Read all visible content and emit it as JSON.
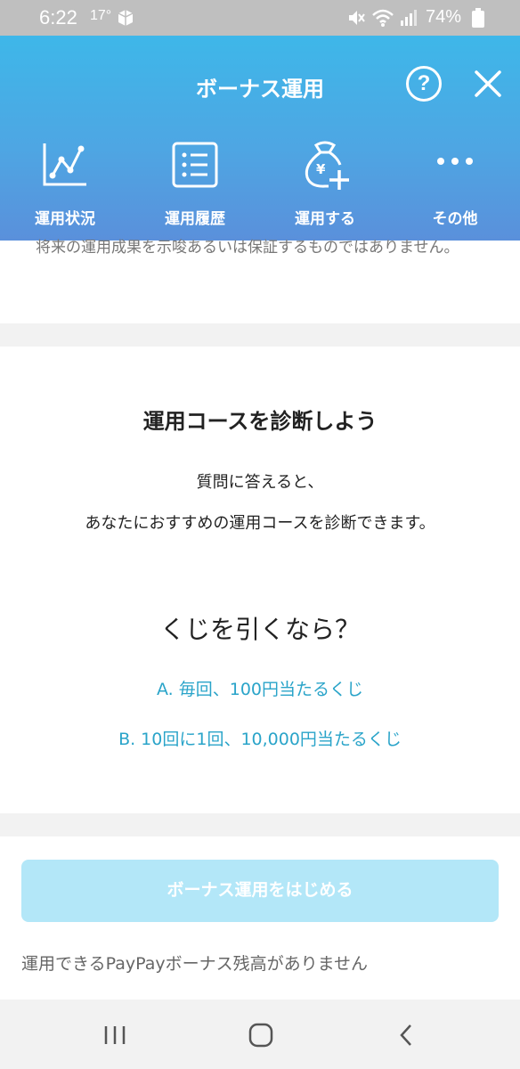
{
  "status_bar": {
    "time": "6:22",
    "temperature": "17°",
    "battery": "74%"
  },
  "header": {
    "title": "ボーナス運用",
    "help": "?",
    "tabs": [
      {
        "label": "運用状況",
        "icon": "chart-icon"
      },
      {
        "label": "運用履歴",
        "icon": "list-icon"
      },
      {
        "label": "運用する",
        "icon": "money-bag-plus-icon"
      },
      {
        "label": "その他",
        "icon": "more-icon"
      }
    ]
  },
  "disclaimer": "将来の運用成果を示唆あるいは保証するものではありません。",
  "diagnosis": {
    "title": "運用コースを診断しよう",
    "desc_line1": "質問に答えると、",
    "desc_line2": "あなたにおすすめの運用コースを診断できます。",
    "question": "くじを引くなら？",
    "options": [
      "A. 毎回、100円当たるくじ",
      "B. 10回に1回、10,000円当たるくじ"
    ]
  },
  "start_button": "ボーナス運用をはじめる",
  "balance_note": "運用できるPayPayボーナス残高がありません",
  "colors": {
    "header_top": "#3eb7e9",
    "header_bottom": "#5a90db",
    "option_text": "#2aa4c9",
    "button_disabled": "#b3e7f8"
  }
}
